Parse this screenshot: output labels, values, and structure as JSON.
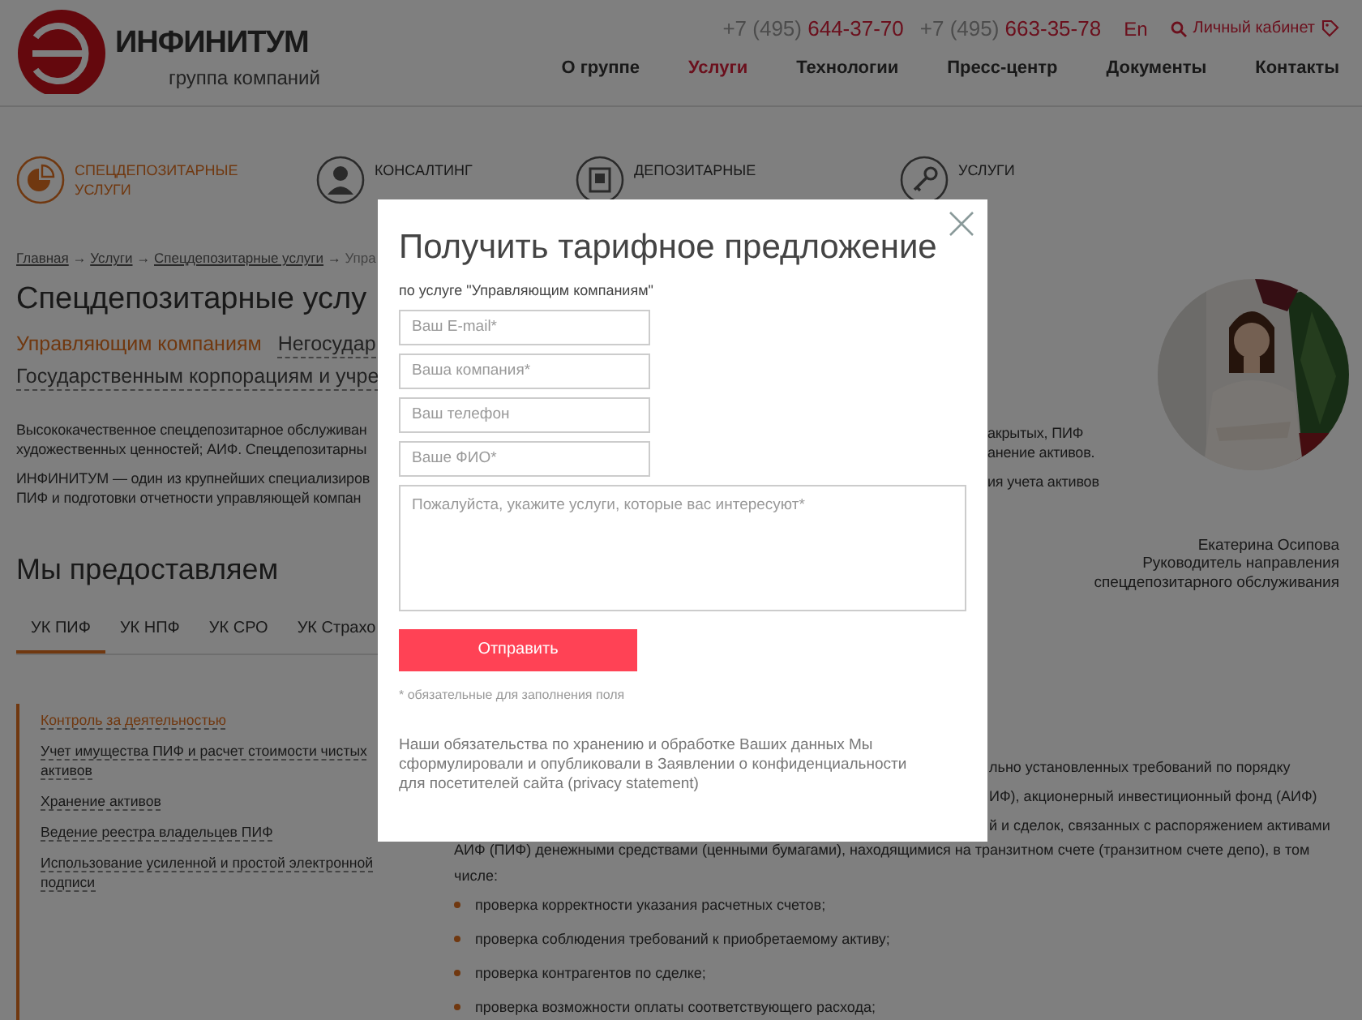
{
  "header": {
    "logo": {
      "name": "ИНФИНИТУМ",
      "tagline": "группа компаний"
    },
    "phones": [
      {
        "code": "+7 (495)",
        "number": "644-37-70"
      },
      {
        "code": "+7 (495)",
        "number": "663-35-78"
      }
    ],
    "language": "En",
    "account_link": "Личный кабинет",
    "nav": [
      {
        "label": "О группе",
        "selected": false
      },
      {
        "label": "Услуги",
        "selected": true
      },
      {
        "label": "Технологии",
        "selected": false
      },
      {
        "label": "Пресс-центр",
        "selected": false
      },
      {
        "label": "Документы",
        "selected": false
      },
      {
        "label": "Контакты",
        "selected": false
      }
    ]
  },
  "services": [
    {
      "label": "СПЕЦДЕПОЗИТАРНЫЕ УСЛУГИ",
      "selected": true
    },
    {
      "label": "КОНСАЛТИНГ",
      "selected": false
    },
    {
      "label": "ДЕПОЗИТАРНЫЕ",
      "selected": false
    },
    {
      "label": "УСЛУГИ",
      "selected": false
    }
  ],
  "breadcrumb": [
    {
      "kind": "link",
      "text": "Главная"
    },
    {
      "kind": "separator",
      "text": "→"
    },
    {
      "kind": "link",
      "text": "Услуги"
    },
    {
      "kind": "separator",
      "text": "→"
    },
    {
      "kind": "link",
      "text": "Спецдепозитарные услуги"
    },
    {
      "kind": "separator",
      "text": "→"
    },
    {
      "kind": "current",
      "text": "Упра"
    }
  ],
  "page_title": "Спецдепозитарные услу",
  "client_links": [
    {
      "label": "Управляющим компаниям",
      "selected": true
    },
    {
      "label": "Негосудар",
      "selected": false
    },
    {
      "label": "Государственным корпорациям и учре",
      "selected": false
    }
  ],
  "intro": [
    {
      "left_lines": [
        "Высококачественное спецдепозитарное обслуживан",
        "художественных ценностей; АИФ. Спецдепозитарны"
      ],
      "right_lines": [
        "акрытых, ПИФ",
        "анение активов."
      ]
    },
    {
      "left_lines": [
        "ИНФИНИТУМ — один из крупнейших специализиров",
        "ПИФ и подготовки отчетности управляющей компан"
      ],
      "right_lines": [
        "ия учета активов"
      ]
    }
  ],
  "contact": {
    "name": "Екатерина Осипова",
    "position": "Руководитель направления спецдепозитарного обслуживания"
  },
  "section_heading": "Мы предоставляем",
  "tabs": [
    {
      "label": "УК ПИФ",
      "selected": true
    },
    {
      "label": "УК НПФ",
      "selected": false
    },
    {
      "label": "УК СРО",
      "selected": false
    },
    {
      "label": "УК Страхо",
      "selected": false
    }
  ],
  "side_menu": [
    {
      "label": "Контроль за деятельностью",
      "selected": true
    },
    {
      "label": "Учет имущества ПИФ и расчет стоимости чистых активов",
      "selected": false
    },
    {
      "label": "Хранение активов",
      "selected": false
    },
    {
      "label": "Ведение реестра владельцев ПИФ",
      "selected": false
    },
    {
      "label": "Использование усиленной и простой электронной подписи",
      "selected": false
    }
  ],
  "content": {
    "fragment_lines": [
      "льно установленных требований по порядку",
      "ИФ), акционерный инвестиционный фонд (АИФ)",
      "й и сделок, связанных с распоряжением активами"
    ],
    "paragraph": "АИФ (ПИФ) денежными средствами (ценными бумагами), находящимися на транзитном счете (транзитном счете депо), в том числе:",
    "bullets": [
      "проверка корректности указания расчетных счетов;",
      "проверка соблюдения требований к приобретаемому активу;",
      "проверка контрагентов по сделке;",
      "проверка возможности оплаты соответствующего расхода;"
    ]
  },
  "modal": {
    "title": "Получить тарифное предложение",
    "subtitle": "по услуге \"Управляющим компаниям\"",
    "fields": [
      {
        "kind": "input",
        "placeholder": "Ваш E-mail*"
      },
      {
        "kind": "input",
        "placeholder": "Ваша компания*"
      },
      {
        "kind": "input",
        "placeholder": "Ваш телефон"
      },
      {
        "kind": "input",
        "placeholder": "Ваше ФИО*"
      },
      {
        "kind": "textarea",
        "placeholder": "Пожалуйста, укажите услуги, которые вас интересуют*"
      }
    ],
    "submit": "Отправить",
    "required_note": "* обязательные для заполнения поля",
    "privacy_note": "Наши обязательства по хранению и обработке Ваших данных Мы сформулировали и опубликовали в Заявлении о конфиденциальности для посетителей сайта (privacy statement)"
  }
}
